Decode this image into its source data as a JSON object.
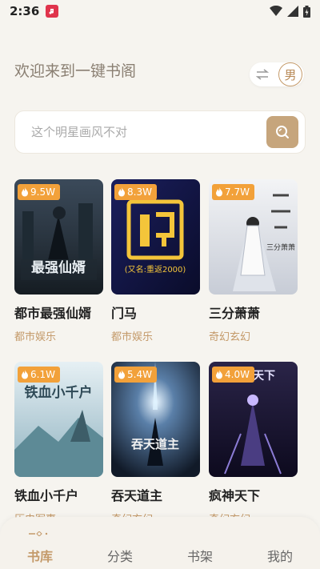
{
  "status_bar": {
    "time": "2:36"
  },
  "header": {
    "welcome": "欢迎来到一键书阁",
    "gender_label": "男"
  },
  "search": {
    "placeholder": "这个明星画风不对"
  },
  "books": [
    {
      "title": "都市最强仙婿",
      "genre": "都市娱乐",
      "heat": "9.5W",
      "cover_text": "最强仙婿"
    },
    {
      "title": "门马",
      "genre": "都市娱乐",
      "heat": "8.3W",
      "cover_text": "(又名:重返2000)"
    },
    {
      "title": "三分萧萧",
      "genre": "奇幻玄幻",
      "heat": "7.7W",
      "cover_text": "三分萧萧"
    },
    {
      "title": "铁血小千户",
      "genre": "历史军事",
      "heat": "6.1W",
      "cover_text": "铁血小千户"
    },
    {
      "title": "吞天道主",
      "genre": "奇幻玄幻",
      "heat": "5.4W",
      "cover_text": "吞天道主"
    },
    {
      "title": "疯神天下",
      "genre": "奇幻玄幻",
      "heat": "4.0W",
      "cover_text": "疯神天下"
    }
  ],
  "nav": {
    "library": "书库",
    "category": "分类",
    "shelf": "书架",
    "mine": "我的"
  },
  "colors": {
    "accent": "#c49a6a",
    "badge": "#f2a13a",
    "search_button": "#c6a57c"
  }
}
